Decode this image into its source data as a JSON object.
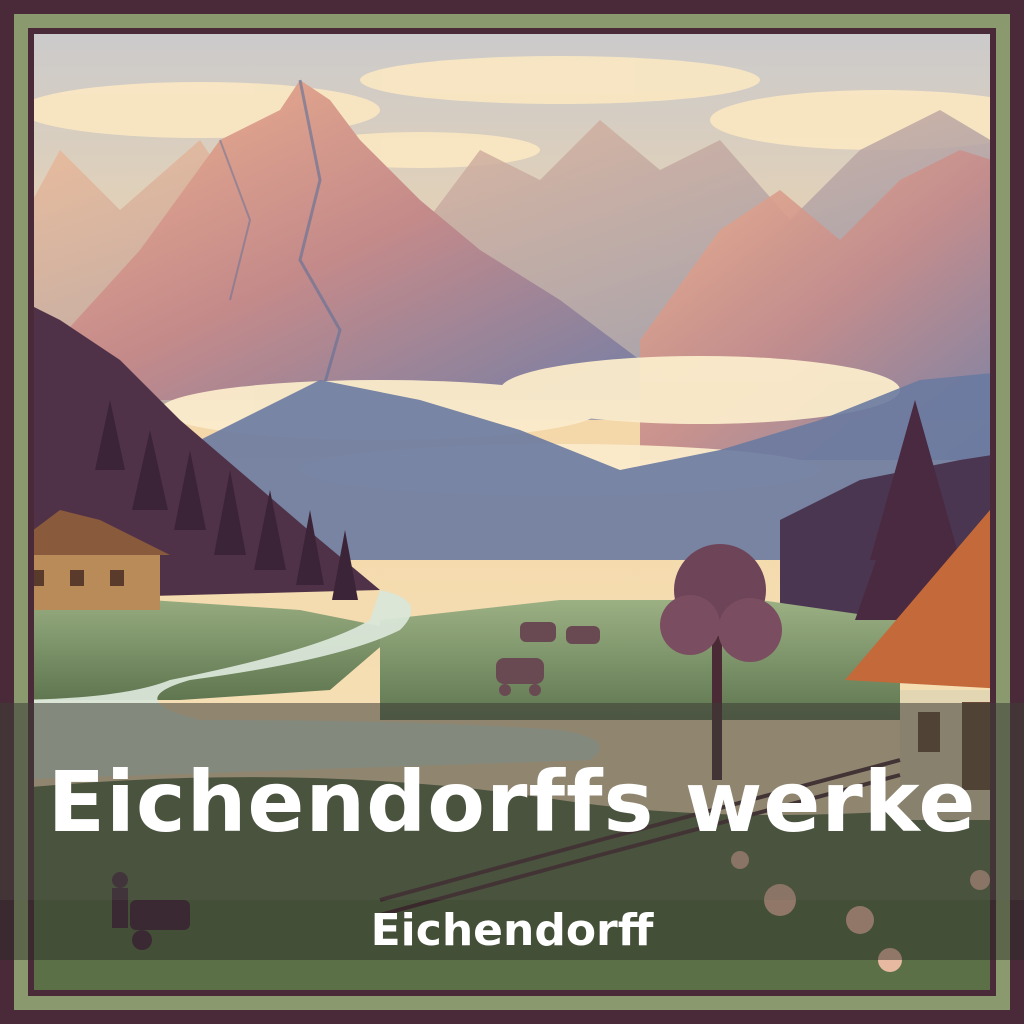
{
  "book": {
    "title": "Eichendorffs werke",
    "author": "Eichendorff"
  },
  "colors": {
    "sky": "#f3dcae",
    "mountain_pink": "#e8a98a",
    "mountain_blue": "#7f8fb0",
    "forest": "#5a3a52",
    "meadow": "#8fa57a",
    "river": "#cfe0d6",
    "roof": "#c46a3a"
  }
}
